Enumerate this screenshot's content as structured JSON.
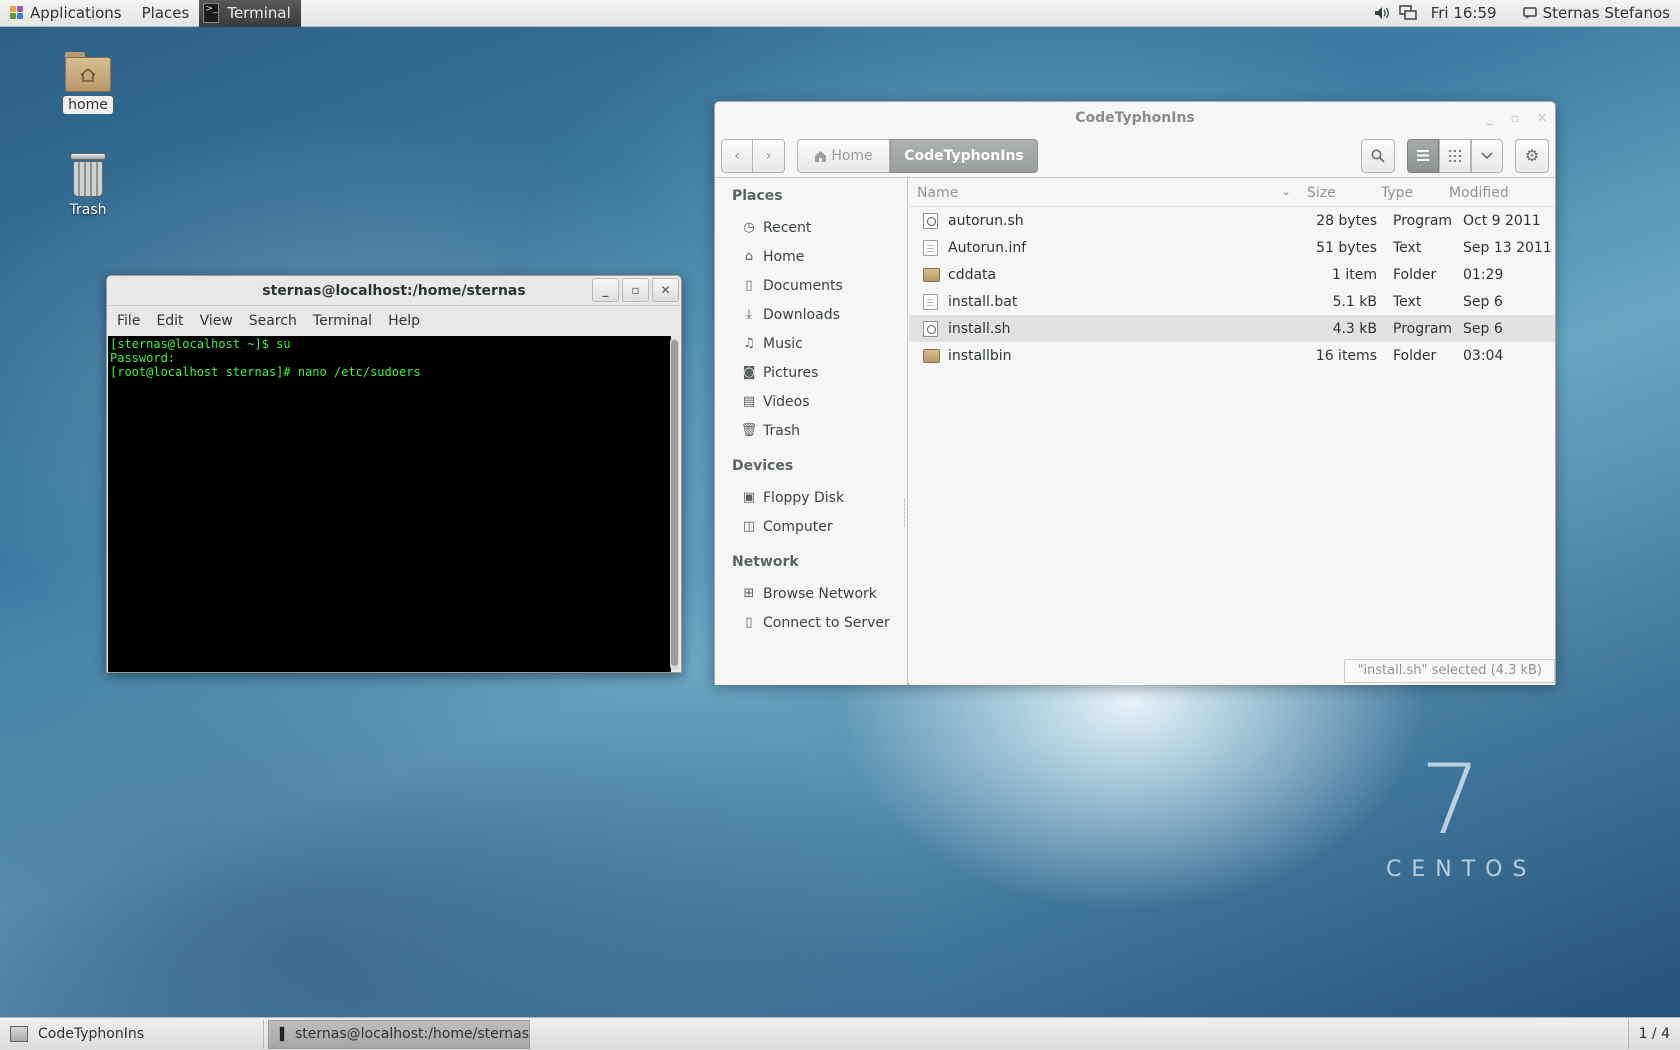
{
  "topbar": {
    "applications": "Applications",
    "places": "Places",
    "active_app": "Terminal",
    "clock": "Fri 16:59",
    "user": "Sternas Stefanos"
  },
  "desktop": {
    "icons": [
      {
        "label": "home",
        "icon": "folder-home-icon"
      },
      {
        "label": "Trash",
        "icon": "trash-icon"
      }
    ],
    "logo_number": "7",
    "logo_text": "CENTOS"
  },
  "terminal": {
    "title": "sternas@localhost:/home/sternas",
    "menu": [
      "File",
      "Edit",
      "View",
      "Search",
      "Terminal",
      "Help"
    ],
    "lines": [
      "[sternas@localhost ~]$ su",
      "Password:",
      "[root@localhost sternas]# nano /etc/sudoers"
    ],
    "text_color": "#3ef23e"
  },
  "filemanager": {
    "title": "CodeTyphonIns",
    "breadcrumb_home": "Home",
    "breadcrumb_current": "CodeTyphonIns",
    "sidebar": {
      "places_header": "Places",
      "places": [
        {
          "label": "Recent",
          "icon": "clock-icon"
        },
        {
          "label": "Home",
          "icon": "home-icon"
        },
        {
          "label": "Documents",
          "icon": "document-icon"
        },
        {
          "label": "Downloads",
          "icon": "download-icon"
        },
        {
          "label": "Music",
          "icon": "music-icon"
        },
        {
          "label": "Pictures",
          "icon": "camera-icon"
        },
        {
          "label": "Videos",
          "icon": "film-icon"
        },
        {
          "label": "Trash",
          "icon": "trash-icon"
        }
      ],
      "devices_header": "Devices",
      "devices": [
        {
          "label": "Floppy Disk",
          "icon": "floppy-icon"
        },
        {
          "label": "Computer",
          "icon": "computer-icon"
        }
      ],
      "network_header": "Network",
      "network": [
        {
          "label": "Browse Network",
          "icon": "network-icon"
        },
        {
          "label": "Connect to Server",
          "icon": "server-icon"
        }
      ]
    },
    "columns": {
      "name": "Name",
      "size": "Size",
      "type": "Type",
      "modified": "Modified"
    },
    "files": [
      {
        "name": "autorun.sh",
        "size": "28 bytes",
        "type": "Program",
        "modified": "Oct 9 2011",
        "icon": "program-icon"
      },
      {
        "name": "Autorun.inf",
        "size": "51 bytes",
        "type": "Text",
        "modified": "Sep 13 2011",
        "icon": "text-file-icon"
      },
      {
        "name": "cddata",
        "size": "1 item",
        "type": "Folder",
        "modified": "01:29",
        "icon": "folder-icon"
      },
      {
        "name": "install.bat",
        "size": "5.1 kB",
        "type": "Text",
        "modified": "Sep 6",
        "icon": "text-file-icon"
      },
      {
        "name": "install.sh",
        "size": "4.3 kB",
        "type": "Program",
        "modified": "Sep 6",
        "icon": "program-icon",
        "selected": true
      },
      {
        "name": "installbin",
        "size": "16 items",
        "type": "Folder",
        "modified": "03:04",
        "icon": "folder-icon"
      }
    ],
    "status": "\"install.sh\" selected (4.3 kB)"
  },
  "taskbar": {
    "tasks": [
      {
        "label": "CodeTyphonIns"
      },
      {
        "label": "sternas@localhost:/home/sternas"
      }
    ],
    "workspace": "1 / 4"
  }
}
